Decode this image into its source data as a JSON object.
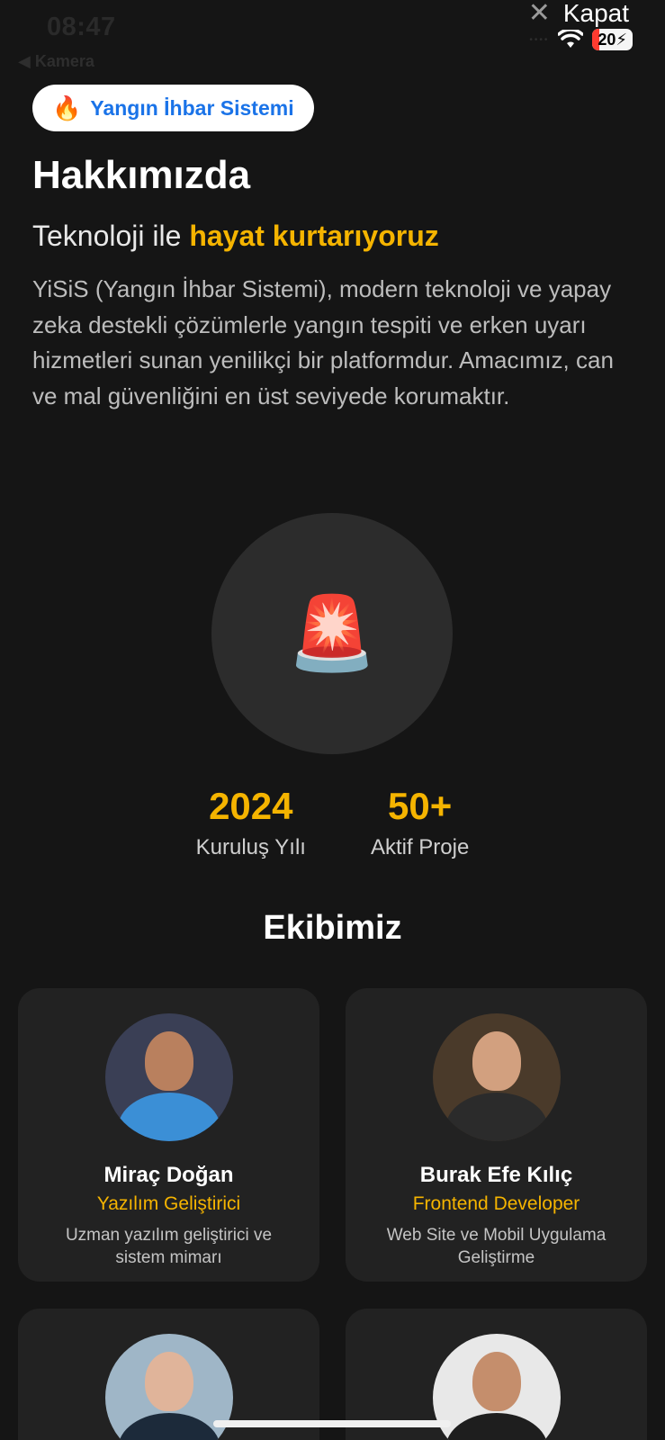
{
  "status_bar": {
    "time": "08:47",
    "back_label": "◀ Kamera",
    "battery": "20",
    "signal_dots": "••••"
  },
  "close": {
    "icon": "close-icon",
    "label": "Kapat"
  },
  "badge": {
    "icon": "🔥",
    "label": "Yangın İhbar Sistemi"
  },
  "page": {
    "title": "Hakkımızda",
    "subtitle_prefix": "Teknoloji ile ",
    "subtitle_highlight": "hayat kurtarıyoruz",
    "description": "YiSiS (Yangın İhbar Sistemi), modern teknoloji ve yapay zeka destekli çözümlerle yangın tespiti ve erken uyarı hizmetleri sunan yenilikçi bir platformdur. Amacımız, can ve mal güvenliğini en üst seviyede korumaktır."
  },
  "hero": {
    "icon": "🚨"
  },
  "stats": [
    {
      "value": "2024",
      "label": "Kuruluş Yılı"
    },
    {
      "value": "50+",
      "label": "Aktif Proje"
    }
  ],
  "team": {
    "title": "Ekibimiz",
    "members": [
      {
        "name": "Miraç Doğan",
        "role": "Yazılım Geliştirici",
        "desc": "Uzman yazılım geliştirici ve sistem mimarı"
      },
      {
        "name": "Burak Efe Kılıç",
        "role": "Frontend Developer",
        "desc": "Web Site ve Mobil Uygulama Geliştirme"
      },
      {
        "name": "",
        "role": "",
        "desc": ""
      },
      {
        "name": "",
        "role": "",
        "desc": ""
      }
    ]
  },
  "colors": {
    "accent": "#f5b400",
    "background": "#151515",
    "card": "#222222",
    "link": "#1a73e8"
  }
}
